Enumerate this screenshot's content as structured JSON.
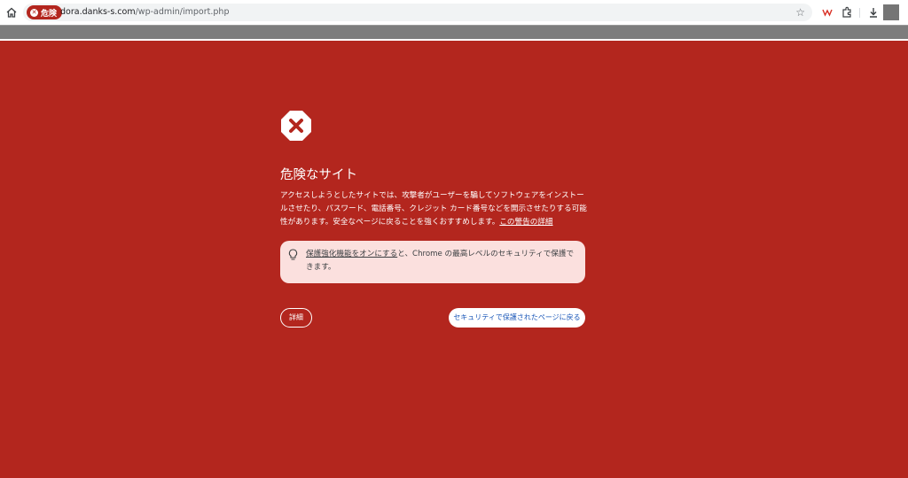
{
  "browser": {
    "security_chip": "危険",
    "url_domain": "dora.danks-s.com",
    "url_path": "/wp-admin/import.php",
    "icons": [
      "home-icon",
      "danger-icon",
      "star-icon",
      "extension-w-icon",
      "puzzle-extensions-icon",
      "download-icon",
      "profile-icon"
    ]
  },
  "interstitial": {
    "icon": "red-octagon-x-icon",
    "title": "危険なサイト",
    "body": "アクセスしようとしたサイトでは、攻撃者がユーザーを騙してソフトウェアをインストールさせたり、パスワード、電話番号、クレジット カード番号などを開示させたりする可能性があります。安全なページに戻ることを強くおすすめします。",
    "details_link": "この警告の詳細",
    "tip_link": "保護強化機能をオンにする",
    "tip_text": "と、Chrome の最高レベルのセキュリティで保護できます。",
    "details_button": "詳細",
    "back_button": "セキュリティで保護されたページに戻る"
  },
  "colors": {
    "background": "#b3261e",
    "tip_background": "#fbe0de",
    "back_button_text": "#1a57b8"
  }
}
